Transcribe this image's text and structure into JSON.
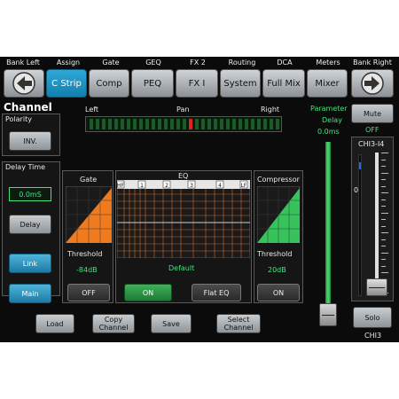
{
  "top_labels": [
    "Bank Left",
    "Assign",
    "Gate",
    "GEQ",
    "FX 2",
    "Routing",
    "DCA",
    "Meters",
    "Bank Right"
  ],
  "nav_buttons": [
    "C Strip",
    "Comp",
    "PEQ",
    "FX I",
    "System",
    "Full Mix",
    "Mixer"
  ],
  "title": "Channel",
  "polarity": {
    "label": "Polarity",
    "button": "INV."
  },
  "delay_time": {
    "label": "Delay Time",
    "value": "0.0mS",
    "button": "Delay"
  },
  "link_button": "Link",
  "main_button": "Main",
  "pan": {
    "left": "Left",
    "center": "Pan",
    "right": "Right"
  },
  "parameter": {
    "label": "Parameter",
    "name": "Delay",
    "value": "0.0ms"
  },
  "gate": {
    "title": "Gate",
    "threshold_label": "Threshold",
    "threshold_value": "-84dB",
    "button": "OFF"
  },
  "eq": {
    "title": "EQ",
    "hf": "HF",
    "lf": "LF",
    "bands": [
      "1",
      "2",
      "3",
      "4"
    ],
    "preset": "Default",
    "on_button": "ON",
    "flat_button": "Flat EQ"
  },
  "compressor": {
    "title": "Compressor",
    "threshold_label": "Threshold",
    "threshold_value": "20dB",
    "button": "ON"
  },
  "mute": {
    "button": "Mute",
    "state": "OFF"
  },
  "fader": {
    "channel_label": "CHI3-I4",
    "zero_label": "0",
    "solo_button": "Solo",
    "bottom_label": "CHI3"
  },
  "bottom_buttons": {
    "load": "Load",
    "copy": "Copy Channel",
    "save": "Save",
    "select": "Select Channel"
  },
  "colors": {
    "accent_blue": "#1e90c8",
    "accent_green": "#3ee67a",
    "gate_orange": "#f07a1e",
    "compressor_green": "#35c35a",
    "pan_red": "#e52020"
  }
}
